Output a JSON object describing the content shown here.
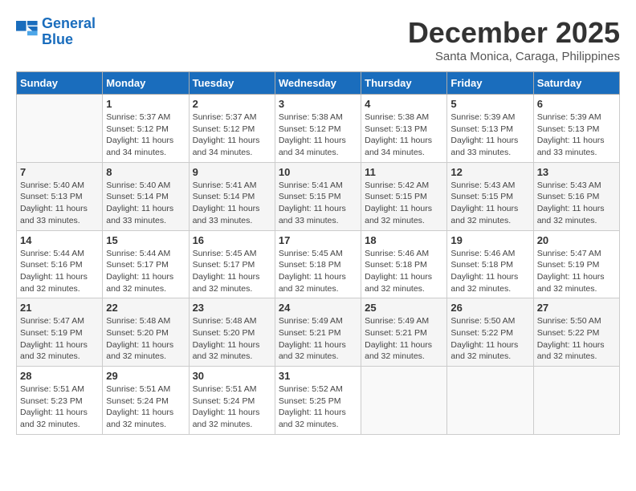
{
  "header": {
    "logo_line1": "General",
    "logo_line2": "Blue",
    "month_title": "December 2025",
    "location": "Santa Monica, Caraga, Philippines"
  },
  "days_of_week": [
    "Sunday",
    "Monday",
    "Tuesday",
    "Wednesday",
    "Thursday",
    "Friday",
    "Saturday"
  ],
  "weeks": [
    [
      {
        "day": "",
        "info": ""
      },
      {
        "day": "1",
        "info": "Sunrise: 5:37 AM\nSunset: 5:12 PM\nDaylight: 11 hours\nand 34 minutes."
      },
      {
        "day": "2",
        "info": "Sunrise: 5:37 AM\nSunset: 5:12 PM\nDaylight: 11 hours\nand 34 minutes."
      },
      {
        "day": "3",
        "info": "Sunrise: 5:38 AM\nSunset: 5:12 PM\nDaylight: 11 hours\nand 34 minutes."
      },
      {
        "day": "4",
        "info": "Sunrise: 5:38 AM\nSunset: 5:13 PM\nDaylight: 11 hours\nand 34 minutes."
      },
      {
        "day": "5",
        "info": "Sunrise: 5:39 AM\nSunset: 5:13 PM\nDaylight: 11 hours\nand 33 minutes."
      },
      {
        "day": "6",
        "info": "Sunrise: 5:39 AM\nSunset: 5:13 PM\nDaylight: 11 hours\nand 33 minutes."
      }
    ],
    [
      {
        "day": "7",
        "info": "Sunrise: 5:40 AM\nSunset: 5:13 PM\nDaylight: 11 hours\nand 33 minutes."
      },
      {
        "day": "8",
        "info": "Sunrise: 5:40 AM\nSunset: 5:14 PM\nDaylight: 11 hours\nand 33 minutes."
      },
      {
        "day": "9",
        "info": "Sunrise: 5:41 AM\nSunset: 5:14 PM\nDaylight: 11 hours\nand 33 minutes."
      },
      {
        "day": "10",
        "info": "Sunrise: 5:41 AM\nSunset: 5:15 PM\nDaylight: 11 hours\nand 33 minutes."
      },
      {
        "day": "11",
        "info": "Sunrise: 5:42 AM\nSunset: 5:15 PM\nDaylight: 11 hours\nand 32 minutes."
      },
      {
        "day": "12",
        "info": "Sunrise: 5:43 AM\nSunset: 5:15 PM\nDaylight: 11 hours\nand 32 minutes."
      },
      {
        "day": "13",
        "info": "Sunrise: 5:43 AM\nSunset: 5:16 PM\nDaylight: 11 hours\nand 32 minutes."
      }
    ],
    [
      {
        "day": "14",
        "info": "Sunrise: 5:44 AM\nSunset: 5:16 PM\nDaylight: 11 hours\nand 32 minutes."
      },
      {
        "day": "15",
        "info": "Sunrise: 5:44 AM\nSunset: 5:17 PM\nDaylight: 11 hours\nand 32 minutes."
      },
      {
        "day": "16",
        "info": "Sunrise: 5:45 AM\nSunset: 5:17 PM\nDaylight: 11 hours\nand 32 minutes."
      },
      {
        "day": "17",
        "info": "Sunrise: 5:45 AM\nSunset: 5:18 PM\nDaylight: 11 hours\nand 32 minutes."
      },
      {
        "day": "18",
        "info": "Sunrise: 5:46 AM\nSunset: 5:18 PM\nDaylight: 11 hours\nand 32 minutes."
      },
      {
        "day": "19",
        "info": "Sunrise: 5:46 AM\nSunset: 5:18 PM\nDaylight: 11 hours\nand 32 minutes."
      },
      {
        "day": "20",
        "info": "Sunrise: 5:47 AM\nSunset: 5:19 PM\nDaylight: 11 hours\nand 32 minutes."
      }
    ],
    [
      {
        "day": "21",
        "info": "Sunrise: 5:47 AM\nSunset: 5:19 PM\nDaylight: 11 hours\nand 32 minutes."
      },
      {
        "day": "22",
        "info": "Sunrise: 5:48 AM\nSunset: 5:20 PM\nDaylight: 11 hours\nand 32 minutes."
      },
      {
        "day": "23",
        "info": "Sunrise: 5:48 AM\nSunset: 5:20 PM\nDaylight: 11 hours\nand 32 minutes."
      },
      {
        "day": "24",
        "info": "Sunrise: 5:49 AM\nSunset: 5:21 PM\nDaylight: 11 hours\nand 32 minutes."
      },
      {
        "day": "25",
        "info": "Sunrise: 5:49 AM\nSunset: 5:21 PM\nDaylight: 11 hours\nand 32 minutes."
      },
      {
        "day": "26",
        "info": "Sunrise: 5:50 AM\nSunset: 5:22 PM\nDaylight: 11 hours\nand 32 minutes."
      },
      {
        "day": "27",
        "info": "Sunrise: 5:50 AM\nSunset: 5:22 PM\nDaylight: 11 hours\nand 32 minutes."
      }
    ],
    [
      {
        "day": "28",
        "info": "Sunrise: 5:51 AM\nSunset: 5:23 PM\nDaylight: 11 hours\nand 32 minutes."
      },
      {
        "day": "29",
        "info": "Sunrise: 5:51 AM\nSunset: 5:24 PM\nDaylight: 11 hours\nand 32 minutes."
      },
      {
        "day": "30",
        "info": "Sunrise: 5:51 AM\nSunset: 5:24 PM\nDaylight: 11 hours\nand 32 minutes."
      },
      {
        "day": "31",
        "info": "Sunrise: 5:52 AM\nSunset: 5:25 PM\nDaylight: 11 hours\nand 32 minutes."
      },
      {
        "day": "",
        "info": ""
      },
      {
        "day": "",
        "info": ""
      },
      {
        "day": "",
        "info": ""
      }
    ]
  ]
}
